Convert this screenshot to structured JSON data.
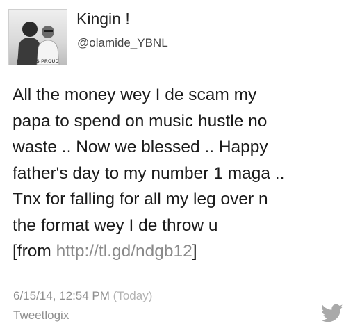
{
  "profile": {
    "display_name": "Kingin !",
    "handle": "@olamide_YBNL",
    "avatar_caption": "MAKE US PROUD"
  },
  "tweet": {
    "lines": [
      "All the money wey I de scam my",
      "papa to spend on music hustle no",
      "waste .. Now we blessed .. Happy",
      "father's day to my number 1 maga ..",
      "Tnx for falling for all my leg over n",
      "the format wey I de throw u"
    ],
    "from_prefix": "[from ",
    "link": "http://tl.gd/ndgb12",
    "from_suffix": "]"
  },
  "meta": {
    "timestamp": "6/15/14, 12:54 PM",
    "relative": "(Today)",
    "source": "Tweetlogix"
  },
  "icons": {
    "brand": "twitter-bird-icon",
    "bird_color": "#a9a9a9"
  }
}
